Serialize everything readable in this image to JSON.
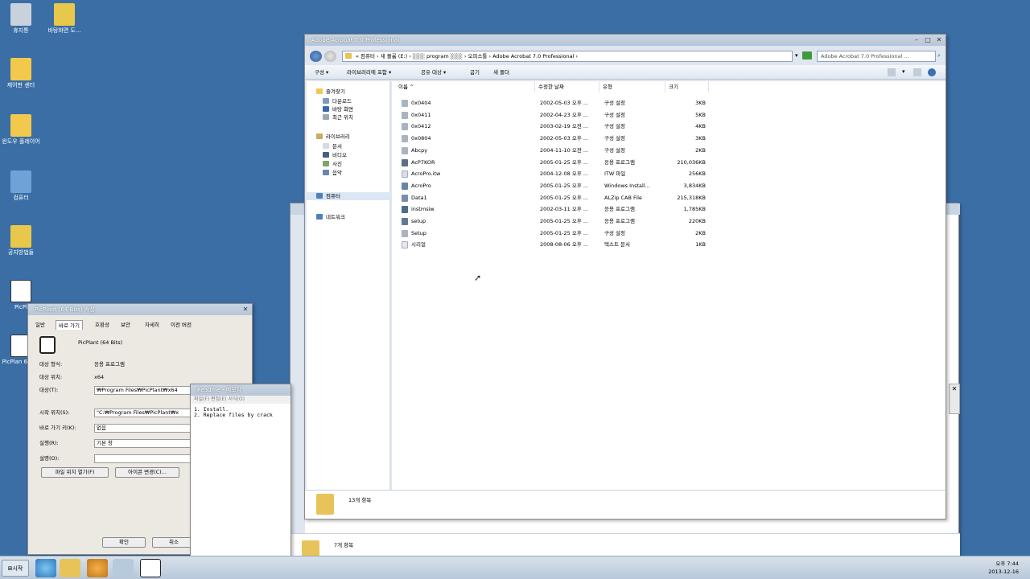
{
  "desktop": {
    "icons": [
      {
        "label": "휴지통",
        "color": "#c8d2dc"
      },
      {
        "label": "바탕화면 도...",
        "color": "#e8c84a"
      },
      {
        "label": "제어판 센터",
        "color": "#f2c94c"
      },
      {
        "label": "윈도우 플레이어",
        "color": "#f2c94c"
      },
      {
        "label": "컴퓨터",
        "color": "#6fa3d8"
      },
      {
        "label": "공지방법들",
        "color": "#e8c84a"
      },
      {
        "label": "PicPl",
        "color": "#ffffff"
      },
      {
        "label": "PicPlan 6 Bits",
        "color": "#ffffff"
      }
    ]
  },
  "explorer": {
    "title": "Adobe Acrobat 7.0 Professional",
    "address": "« 컴퓨터 › 새 볼륨 (E:) › ░░░ program ░░░ › 오피스툴 › Adobe Acrobat 7.0 Professional ›",
    "search_placeholder": "Adobe Acrobat 7.0 Professional ...",
    "toolbar": [
      "구성 ▾",
      "라이브러리에 포함 ▾",
      "공유 대상 ▾",
      "굽기",
      "새 폴더"
    ],
    "nav": {
      "favorites": "즐겨찾기",
      "favorites_items": [
        "다운로드",
        "바탕 화면",
        "최근 위치"
      ],
      "libraries": "라이브러리",
      "library_items": [
        "문서",
        "비디오",
        "사진",
        "음악"
      ],
      "computer": "컴퓨터",
      "network": "네트워크"
    },
    "columns": [
      "이름",
      "수정한 날짜",
      "유형",
      "크기"
    ],
    "files": [
      {
        "name": "0x0404",
        "date": "2002-05-03 오후 ...",
        "type": "구성 설정",
        "size": "3KB",
        "color": "#a9b4c0"
      },
      {
        "name": "0x0411",
        "date": "2002-04-23 오후 ...",
        "type": "구성 설정",
        "size": "5KB",
        "color": "#a9b4c0"
      },
      {
        "name": "0x0412",
        "date": "2003-02-19 오전 ...",
        "type": "구성 설정",
        "size": "4KB",
        "color": "#a9b4c0"
      },
      {
        "name": "0x0804",
        "date": "2002-05-03 오후 ...",
        "type": "구성 설정",
        "size": "3KB",
        "color": "#a9b4c0"
      },
      {
        "name": "Abcpy",
        "date": "2004-11-10 오전 ...",
        "type": "구성 설정",
        "size": "2KB",
        "color": "#a9b4c0"
      },
      {
        "name": "AcP7KOR",
        "date": "2005-01-25 오후 ...",
        "type": "응용 프로그램",
        "size": "210,036KB",
        "color": "#5e6f86"
      },
      {
        "name": "AcroPro.itw",
        "date": "2004-12-08 오후 ...",
        "type": "ITW 파일",
        "size": "256KB",
        "color": "#d9dee4"
      },
      {
        "name": "AcroPro",
        "date": "2005-01-25 오후 ...",
        "type": "Windows Install...",
        "size": "3,834KB",
        "color": "#6c85a6"
      },
      {
        "name": "Data1",
        "date": "2005-01-25 오후 ...",
        "type": "ALZip CAB File",
        "size": "215,318KB",
        "color": "#7a8ea8"
      },
      {
        "name": "instmsiw",
        "date": "2002-03-11 오후 ...",
        "type": "응용 프로그램",
        "size": "1,785KB",
        "color": "#4f6a8c"
      },
      {
        "name": "setup",
        "date": "2005-01-25 오후 ...",
        "type": "응용 프로그램",
        "size": "220KB",
        "color": "#5f7898"
      },
      {
        "name": "Setup",
        "date": "2005-01-25 오후 ...",
        "type": "구성 설정",
        "size": "2KB",
        "color": "#a9b4c0"
      },
      {
        "name": "시리얼",
        "date": "2008-08-06 오후 ...",
        "type": "텍스트 문서",
        "size": "1KB",
        "color": "#e4e8ec"
      }
    ],
    "status": "13개 항목"
  },
  "properties": {
    "title": "PicPlant (64 Bits) 속성",
    "tabs": [
      "일반",
      "바로 가기",
      "호환성",
      "보안",
      "자세히",
      "이전 버전"
    ],
    "app_name": "PicPlant (64 Bits)",
    "rows": [
      {
        "label": "대상 형식:",
        "value": "응용 프로그램"
      },
      {
        "label": "대상 위치:",
        "value": "x64"
      },
      {
        "label": "대상(T):",
        "value": "₩Program Files₩PicPlant₩x64"
      }
    ],
    "fields": [
      {
        "label": "시작 위치(S):",
        "value": "\"C:₩Program Files₩PicPlant₩x"
      },
      {
        "label": "바로 가기 키(K):",
        "value": "없음"
      },
      {
        "label": "실행(R):",
        "value": "기본 창"
      },
      {
        "label": "설명(O):",
        "value": ""
      }
    ],
    "buttons": [
      "파일 위치 열기(F)",
      "아이콘 변경(C)...",
      "확인",
      "취소"
    ]
  },
  "readme": {
    "title": "Readme - 메모장",
    "menu": "파일(F) 편집(E) 서식(O)",
    "lines": [
      "1. Install.",
      "2. Replace files by crack"
    ]
  },
  "folder2": {
    "status": "7개 항목"
  },
  "taskbar": {
    "start_label": "시작",
    "time": "오후 7:44",
    "date": "2013-12-16"
  },
  "colors": {
    "desktop": "#3a6ea5",
    "folder": "#e8c35a"
  }
}
